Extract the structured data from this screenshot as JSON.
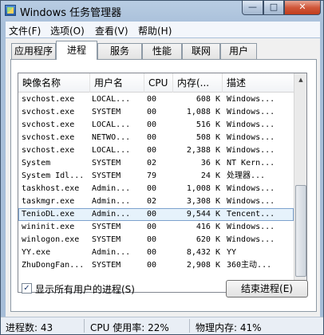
{
  "window": {
    "title": "Windows 任务管理器",
    "minimize_glyph": "—",
    "maximize_glyph": "□",
    "close_glyph": "✕"
  },
  "menu": [
    "文件(F)",
    "选项(O)",
    "查看(V)",
    "帮助(H)"
  ],
  "tabs": [
    "应用程序",
    "进程",
    "服务",
    "性能",
    "联网",
    "用户"
  ],
  "active_tab": "进程",
  "columns": [
    "映像名称",
    "用户名",
    "CPU",
    "内存(...",
    "描述"
  ],
  "processes": [
    {
      "name": "svchost.exe",
      "user": "LOCAL...",
      "cpu": "00",
      "mem": "608 K",
      "desc": "Windows..."
    },
    {
      "name": "svchost.exe",
      "user": "SYSTEM",
      "cpu": "00",
      "mem": "1,088 K",
      "desc": "Windows..."
    },
    {
      "name": "svchost.exe",
      "user": "LOCAL...",
      "cpu": "00",
      "mem": "516 K",
      "desc": "Windows..."
    },
    {
      "name": "svchost.exe",
      "user": "NETWO...",
      "cpu": "00",
      "mem": "508 K",
      "desc": "Windows..."
    },
    {
      "name": "svchost.exe",
      "user": "LOCAL...",
      "cpu": "00",
      "mem": "2,388 K",
      "desc": "Windows..."
    },
    {
      "name": "System",
      "user": "SYSTEM",
      "cpu": "02",
      "mem": "36 K",
      "desc": "NT Kern..."
    },
    {
      "name": "System Idl...",
      "user": "SYSTEM",
      "cpu": "79",
      "mem": "24 K",
      "desc": "处理器..."
    },
    {
      "name": "taskhost.exe",
      "user": "Admin...",
      "cpu": "00",
      "mem": "1,008 K",
      "desc": "Windows..."
    },
    {
      "name": "taskmgr.exe",
      "user": "Admin...",
      "cpu": "02",
      "mem": "3,308 K",
      "desc": "Windows..."
    },
    {
      "name": "TenioDL.exe",
      "user": "Admin...",
      "cpu": "00",
      "mem": "9,544 K",
      "desc": "Tencent..."
    },
    {
      "name": "wininit.exe",
      "user": "SYSTEM",
      "cpu": "00",
      "mem": "416 K",
      "desc": "Windows..."
    },
    {
      "name": "winlogon.exe",
      "user": "SYSTEM",
      "cpu": "00",
      "mem": "620 K",
      "desc": "Windows..."
    },
    {
      "name": "YY.exe",
      "user": "Admin...",
      "cpu": "00",
      "mem": "8,432 K",
      "desc": "YY"
    },
    {
      "name": "ZhuDongFan...",
      "user": "SYSTEM",
      "cpu": "00",
      "mem": "2,908 K",
      "desc": "360主动..."
    }
  ],
  "selected_process": "TenioDL.exe",
  "show_all_users": {
    "label": "显示所有用户的进程(S)",
    "checked": true,
    "check_glyph": "✓"
  },
  "end_process_button": "结束进程(E)",
  "status": {
    "process_count": "进程数: 43",
    "cpu_usage": "CPU 使用率: 22%",
    "physical_memory": "物理内存: 41%"
  },
  "icons": {
    "scroll_up": "▲",
    "scroll_down": "▼"
  }
}
